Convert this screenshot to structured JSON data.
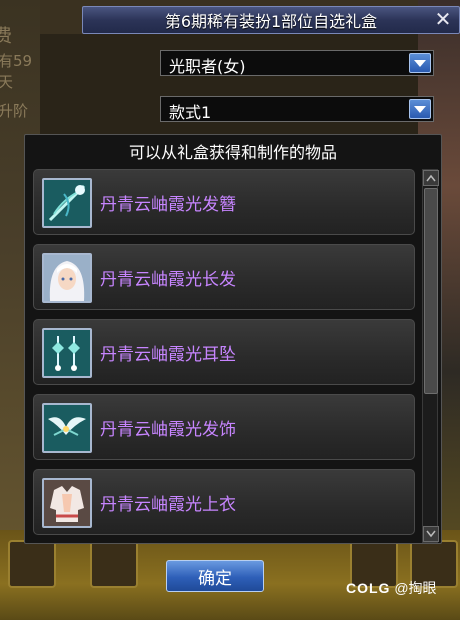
{
  "dialog": {
    "title": "第6期稀有装扮1部位自选礼盒",
    "close_glyph": "✕"
  },
  "selects": {
    "class": {
      "value": "光职者(女)"
    },
    "style": {
      "value": "款式1"
    }
  },
  "panel": {
    "header": "可以从礼盒获得和制作的物品",
    "items": [
      {
        "name": "丹青云岫霞光发簪",
        "icon": "hairpin-icon"
      },
      {
        "name": "丹青云岫霞光长发",
        "icon": "long-hair-portrait-icon"
      },
      {
        "name": "丹青云岫霞光耳坠",
        "icon": "earring-icon"
      },
      {
        "name": "丹青云岫霞光发饰",
        "icon": "hair-ornament-icon"
      },
      {
        "name": "丹青云岫霞光上衣",
        "icon": "top-garment-icon"
      }
    ]
  },
  "confirm_label": "确定",
  "background": {
    "left_text_1": "费",
    "left_text_2": "有59天",
    "left_text_3": "升阶"
  },
  "watermark": {
    "brand": "COLG",
    "author": "@掏眼"
  },
  "colors": {
    "item_name": "#c785ff",
    "title_bar": "#2c3458",
    "button": "#2e5fb8"
  }
}
